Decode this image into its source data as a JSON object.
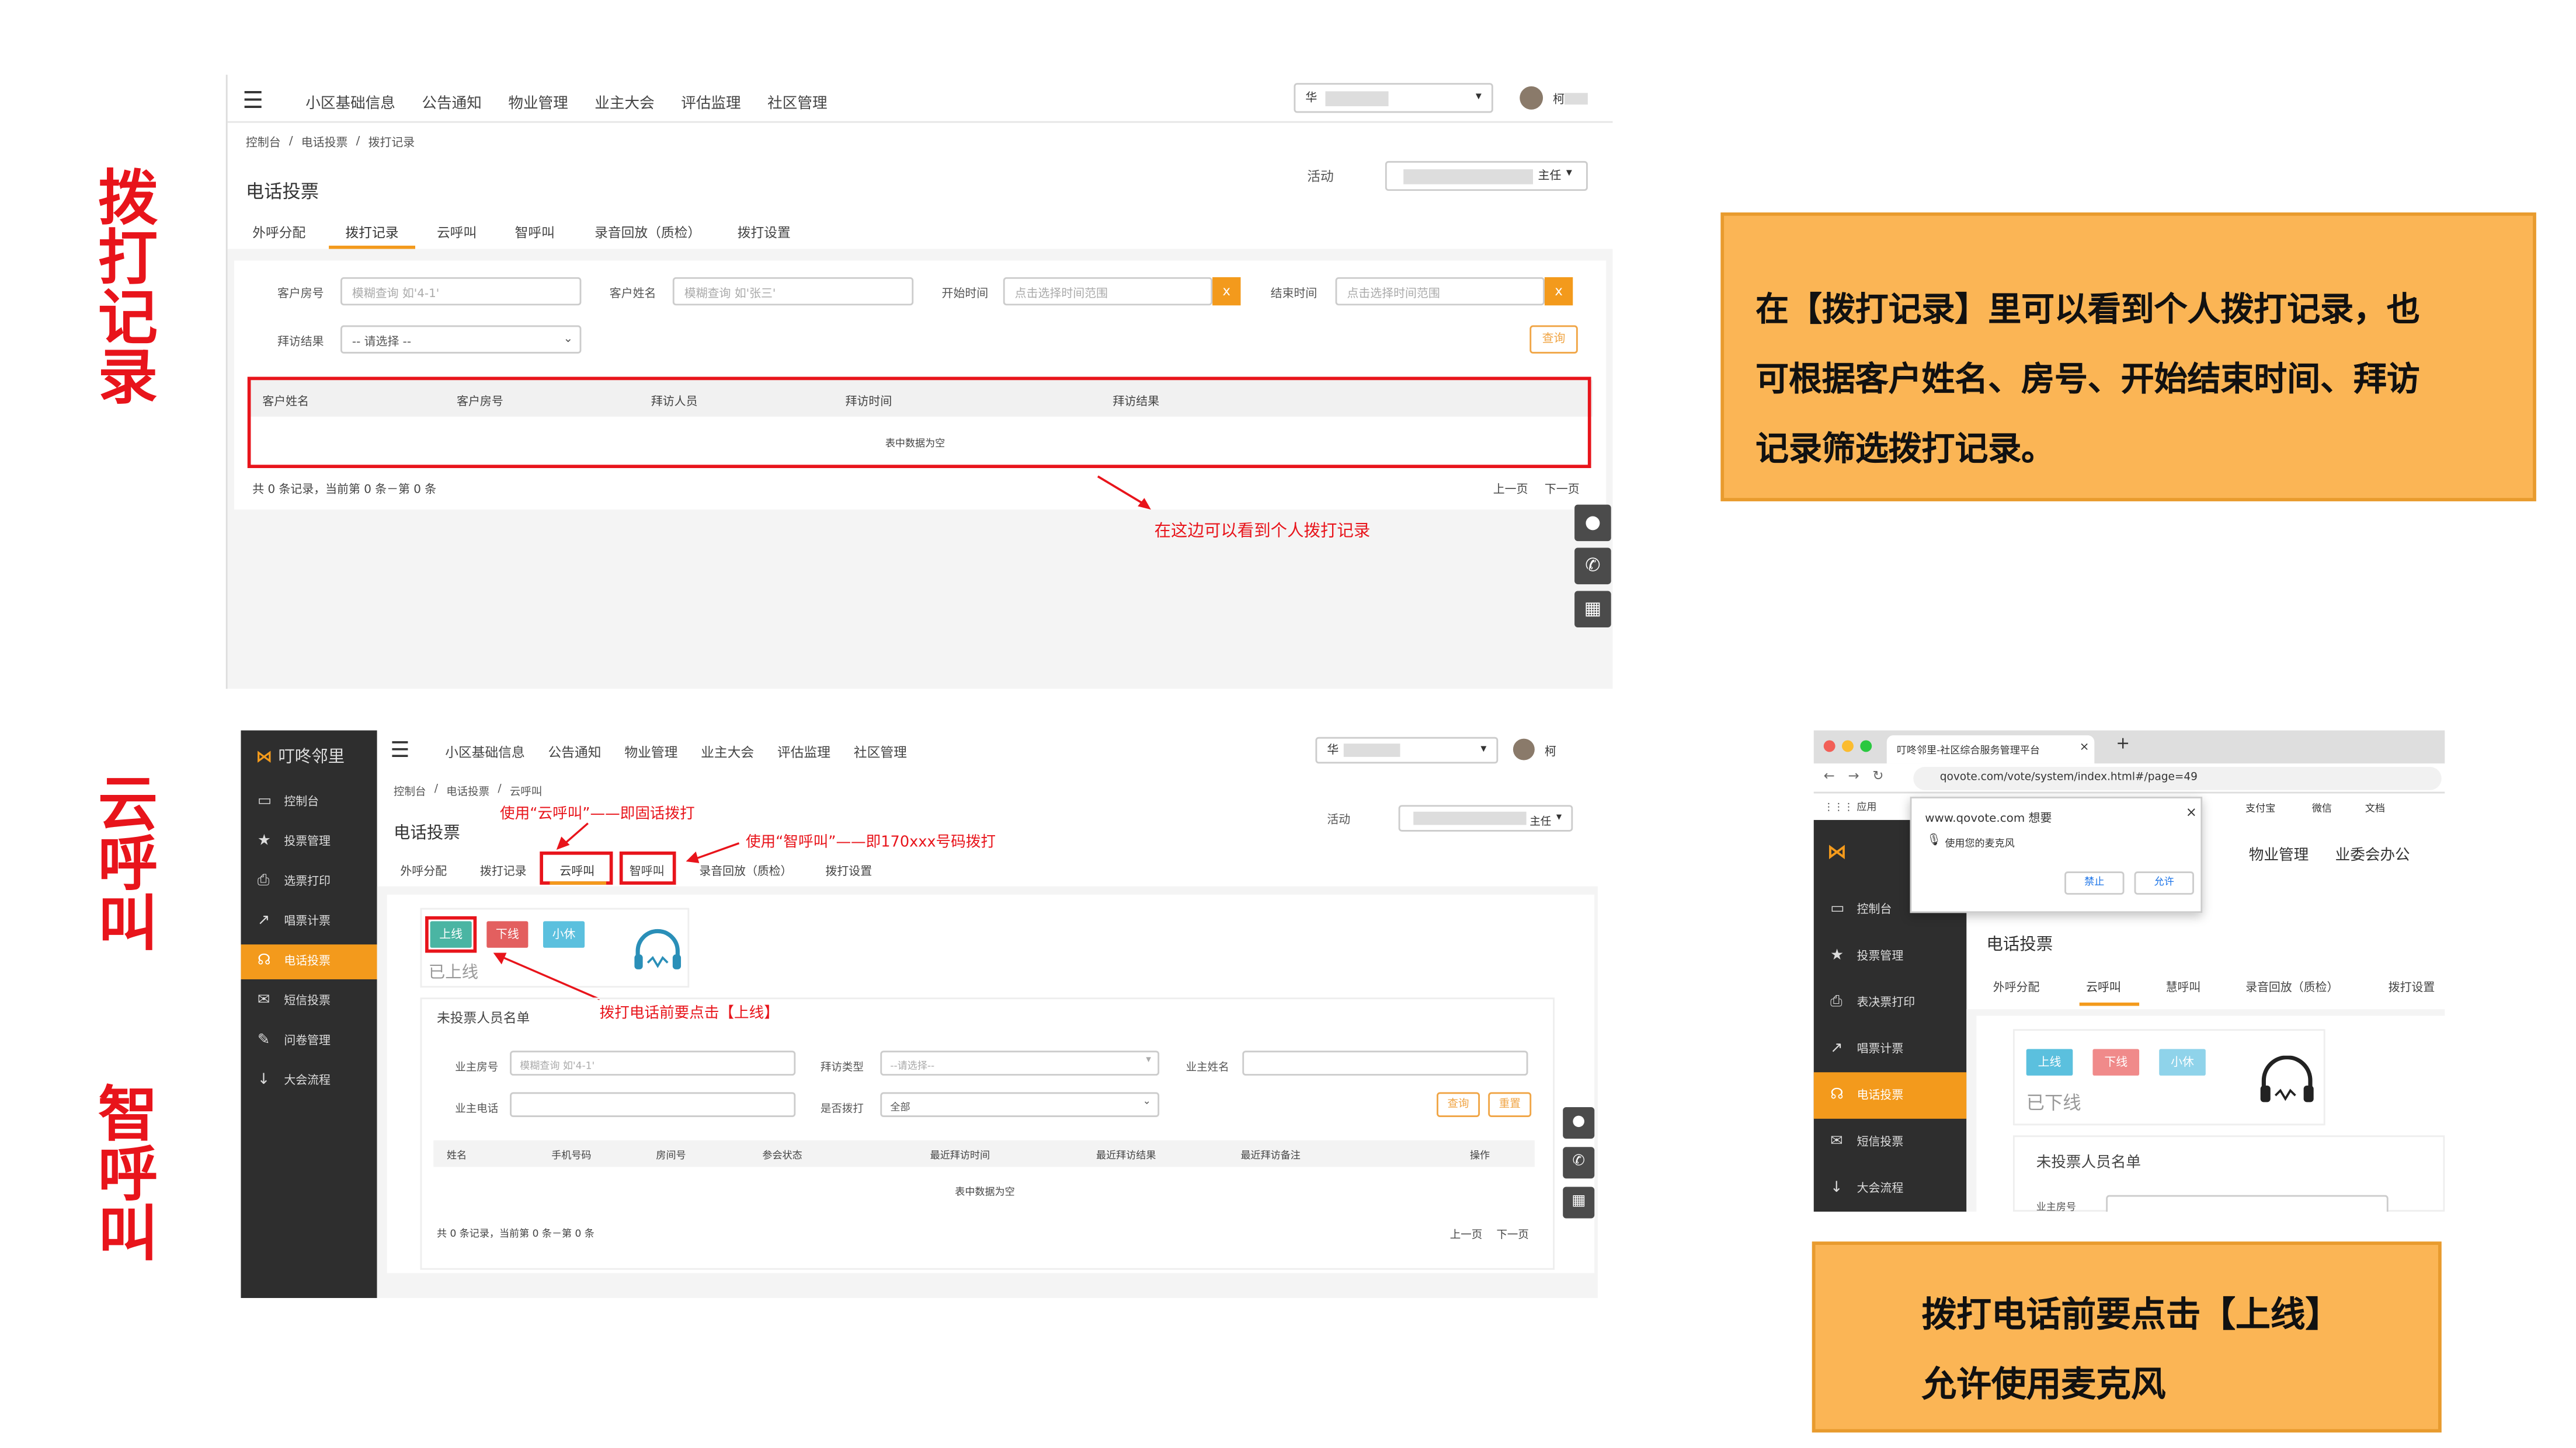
{
  "left_titles": {
    "dial": "拨打记录",
    "cloud": "云呼叫",
    "smart": "智呼叫"
  },
  "s1": {
    "nav": [
      "小区基础信息",
      "公告通知",
      "物业管理",
      "业主大会",
      "评估监理",
      "社区管理"
    ],
    "community": "华",
    "user": "柯",
    "breadcrumb": [
      "控制台",
      "/",
      "电话投票",
      "/",
      "拨打记录"
    ],
    "page_title": "电话投票",
    "activity_label": "活动",
    "activity_suffix": "主任",
    "tabs": [
      "外呼分配",
      "拨打记录",
      "云呼叫",
      "智呼叫",
      "录音回放（质检）",
      "拨打设置"
    ],
    "active_tab": 1,
    "f_room": "客户房号",
    "f_room_ph": "模糊查询 如'4-1'",
    "f_name": "客户姓名",
    "f_name_ph": "模糊查询 如'张三'",
    "f_start": "开始时间",
    "f_start_ph": "点击选择时间范围",
    "f_end": "结束时间",
    "f_end_ph": "点击选择时间范围",
    "f_result": "拜访结果",
    "f_result_ph": "-- 请选择 --",
    "x": "x",
    "query": "查询",
    "cols": [
      "客户姓名",
      "客户房号",
      "拜访人员",
      "拜访时间",
      "拜访结果"
    ],
    "empty": "表中数据为空",
    "summary": "共 0 条记录，当前第 0 条－第 0 条",
    "prev": "上一页",
    "next": "下一页",
    "annotation": "在这边可以看到个人拨打记录"
  },
  "note1": [
    "在【拨打记录】里可以看到个人拨打记录，也",
    "可根据客户姓名、房号、开始结束时间、拜访",
    "记录筛选拨打记录。"
  ],
  "s2": {
    "logo": "叮咚邻里",
    "side": [
      {
        "icon": "▭",
        "label": "控制台"
      },
      {
        "icon": "★",
        "label": "投票管理"
      },
      {
        "icon": "⎙",
        "label": "选票打印"
      },
      {
        "icon": "↗",
        "label": "唱票计票"
      },
      {
        "icon": "☊",
        "label": "电话投票"
      },
      {
        "icon": "✉",
        "label": "短信投票"
      },
      {
        "icon": "✎",
        "label": "问卷管理"
      },
      {
        "icon": "↓",
        "label": "大会流程"
      }
    ],
    "nav": [
      "小区基础信息",
      "公告通知",
      "物业管理",
      "业主大会",
      "评估监理",
      "社区管理"
    ],
    "community": "华",
    "user": "柯",
    "breadcrumb": [
      "控制台",
      "/",
      "电话投票",
      "/",
      "云呼叫"
    ],
    "page_title": "电话投票",
    "activity_label": "活动",
    "activity_suffix": "主任",
    "tabs": [
      "外呼分配",
      "拨打记录",
      "云呼叫",
      "智呼叫",
      "录音回放（质检）",
      "拨打设置"
    ],
    "btn_online": "上线",
    "btn_offline": "下线",
    "btn_rest": "小休",
    "status": "已上线",
    "list_title": "未投票人员名单",
    "f_room": "业主房号",
    "f_room_ph": "模糊查询 如'4-1'",
    "f_type": "拜访类型",
    "f_type_ph": "--请选择--",
    "f_name": "业主姓名",
    "f_phone": "业主电话",
    "f_dialed": "是否拨打",
    "f_dialed_val": "全部",
    "query": "查询",
    "reset": "重置",
    "cols": [
      "姓名",
      "手机号码",
      "房间号",
      "参会状态",
      "最近拜访时间",
      "最近拜访结果",
      "最近拜访备注",
      "操作"
    ],
    "empty": "表中数据为空",
    "summary": "共 0 条记录，当前第 0 条－第 0 条",
    "prev": "上一页",
    "next": "下一页",
    "ann_cloud": "使用“云呼叫”——即固话拨打",
    "ann_smart": "使用“智呼叫”——即170xxx号码拨打",
    "ann_online": "拨打电话前要点击【上线】"
  },
  "s3": {
    "tab_title": "叮咚邻里-社区综合服务管理平台",
    "url": "qovote.com/vote/system/index.html#/page=49",
    "apps": "应用",
    "bookmarks": [
      "支付宝",
      "微信",
      "文档"
    ],
    "popup_title": "www.qovote.com 想要",
    "popup_line": "使用您的麦克风",
    "popup_block": "禁止",
    "popup_allow": "允许",
    "nav": [
      "物业管理",
      "业委会办公"
    ],
    "side": [
      {
        "icon": "▭",
        "label": "控制台"
      },
      {
        "icon": "★",
        "label": "投票管理"
      },
      {
        "icon": "⎙",
        "label": "表决票打印"
      },
      {
        "icon": "↗",
        "label": "唱票计票"
      },
      {
        "icon": "☊",
        "label": "电话投票"
      },
      {
        "icon": "✉",
        "label": "短信投票"
      },
      {
        "icon": "↓",
        "label": "大会流程"
      }
    ],
    "page_title": "电话投票",
    "tabs": [
      "外呼分配",
      "云呼叫",
      "慧呼叫",
      "录音回放（质检）",
      "拨打设置"
    ],
    "btn_online": "上线",
    "btn_offline": "下线",
    "btn_rest": "小休",
    "status": "已下线",
    "list_title": "未投票人员名单",
    "f_room": "业主房号"
  },
  "note2": [
    "拨打电话前要点击【上线】",
    "允许使用麦克风"
  ],
  "colors": {
    "accent_red": "#e8141b",
    "orange_fill": "#fbb555",
    "orange_btn": "#f39a1c",
    "sidebar": "#2e2e2e"
  }
}
